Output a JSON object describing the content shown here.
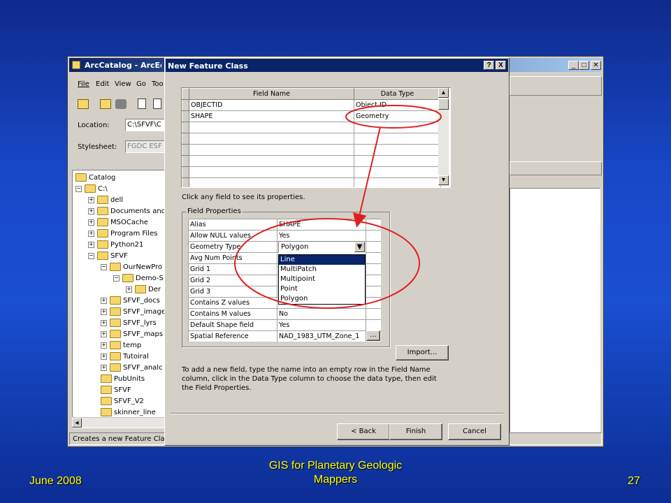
{
  "arccatalog": {
    "title": "ArcCatalog - ArcEdit",
    "menu": [
      "File",
      "Edit",
      "View",
      "Go",
      "Too"
    ],
    "location_label": "Location:",
    "location_value": "C:\\SFVF\\C",
    "stylesheet_label": "Stylesheet:",
    "stylesheet_value": "FGDC ESF",
    "status": "Creates a new Feature Clas",
    "tree": [
      {
        "label": "Catalog",
        "level": 0,
        "toggle": ""
      },
      {
        "label": "C:\\",
        "level": 0,
        "toggle": "−"
      },
      {
        "label": "dell",
        "level": 1,
        "toggle": "+"
      },
      {
        "label": "Documents and",
        "level": 1,
        "toggle": "+"
      },
      {
        "label": "MSOCache",
        "level": 1,
        "toggle": "+"
      },
      {
        "label": "Program Files",
        "level": 1,
        "toggle": "+"
      },
      {
        "label": "Python21",
        "level": 1,
        "toggle": "+"
      },
      {
        "label": "SFVF",
        "level": 1,
        "toggle": "−"
      },
      {
        "label": "OurNewPro",
        "level": 2,
        "toggle": "−"
      },
      {
        "label": "Demo-S",
        "level": 3,
        "toggle": "−"
      },
      {
        "label": "Der",
        "level": 4,
        "toggle": "+"
      },
      {
        "label": "SFVF_docs",
        "level": 2,
        "toggle": "+"
      },
      {
        "label": "SFVF_image",
        "level": 2,
        "toggle": "+"
      },
      {
        "label": "SFVF_lyrs",
        "level": 2,
        "toggle": "+"
      },
      {
        "label": "SFVF_maps",
        "level": 2,
        "toggle": "+"
      },
      {
        "label": "temp",
        "level": 2,
        "toggle": "+"
      },
      {
        "label": "Tutoiral",
        "level": 2,
        "toggle": "+"
      },
      {
        "label": "SFVF_analc",
        "level": 2,
        "toggle": "+"
      },
      {
        "label": "PubUnits",
        "level": 2,
        "toggle": ""
      },
      {
        "label": "SFVF",
        "level": 2,
        "toggle": ""
      },
      {
        "label": "SFVF_V2",
        "level": 2,
        "toggle": ""
      },
      {
        "label": "skinner_line",
        "level": 2,
        "toggle": ""
      }
    ]
  },
  "dialog": {
    "title": "New Feature Class",
    "help_btn": "?",
    "close_btn": "X",
    "col_field_name": "Field Name",
    "col_data_type": "Data Type",
    "fields": [
      {
        "name": "OBJECTID",
        "type": "Object ID"
      },
      {
        "name": "SHAPE",
        "type": "Geometry"
      },
      {
        "name": "",
        "type": ""
      },
      {
        "name": "",
        "type": ""
      },
      {
        "name": "",
        "type": ""
      },
      {
        "name": "",
        "type": ""
      },
      {
        "name": "",
        "type": ""
      },
      {
        "name": "",
        "type": ""
      }
    ],
    "hint": "Click any field to see its properties.",
    "props_group": "Field Properties",
    "props": [
      {
        "k": "Alias",
        "v": "SHAPE"
      },
      {
        "k": "Allow NULL values",
        "v": "Yes"
      },
      {
        "k": "Geometry Type",
        "v": "Polygon"
      },
      {
        "k": "Avg Num Points",
        "v": ""
      },
      {
        "k": "Grid 1",
        "v": ""
      },
      {
        "k": "Grid 2",
        "v": ""
      },
      {
        "k": "Grid 3",
        "v": ""
      },
      {
        "k": "Contains Z values",
        "v": ""
      },
      {
        "k": "Contains M values",
        "v": "No"
      },
      {
        "k": "Default Shape field",
        "v": "Yes"
      },
      {
        "k": "Spatial Reference",
        "v": "NAD_1983_UTM_Zone_1"
      }
    ],
    "dropdown_value": "Polygon",
    "dropdown_options": [
      "Line",
      "MultiPatch",
      "Multipoint",
      "Point",
      "Polygon"
    ],
    "ellipsis": "...",
    "import_btn": "Import...",
    "instructions": "To add a new field, type the name into an empty row in the Field Name column, click in the Data Type column to choose the data type, then edit the Field Properties.",
    "back_btn": "< Back",
    "finish_btn": "Finish",
    "cancel_btn": "Cancel"
  },
  "slide": {
    "date": "June 2008",
    "footer_line1": "GIS for Planetary Geologic",
    "footer_line2": "Mappers",
    "page": "27"
  },
  "colors": {
    "annotation": "#e02020",
    "titlebar": "#0a246a"
  }
}
